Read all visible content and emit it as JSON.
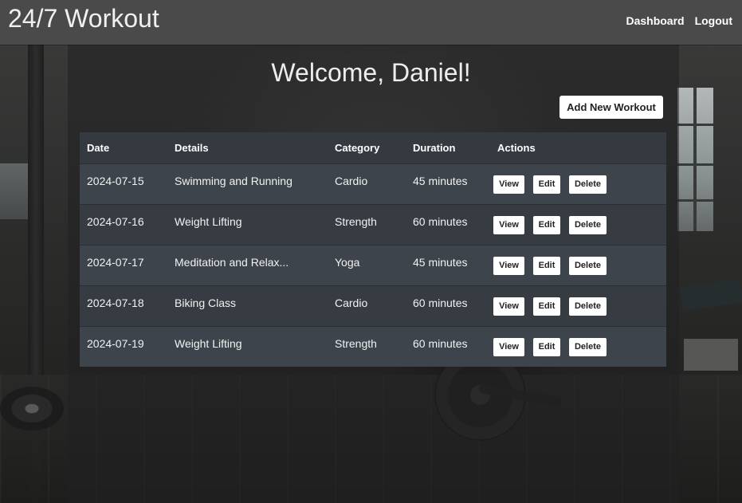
{
  "header": {
    "brand": "24/7 Workout",
    "nav": [
      {
        "label": "Dashboard"
      },
      {
        "label": "Logout"
      }
    ]
  },
  "main": {
    "welcome": "Welcome, Daniel!",
    "add_button_label": "Add New Workout"
  },
  "table": {
    "columns": [
      "Date",
      "Details",
      "Category",
      "Duration",
      "Actions"
    ],
    "rows": [
      {
        "date": "2024-07-15",
        "details": "Swimming and Running",
        "category": "Cardio",
        "duration": "45 minutes"
      },
      {
        "date": "2024-07-16",
        "details": "Weight Lifting",
        "category": "Strength",
        "duration": "60 minutes"
      },
      {
        "date": "2024-07-17",
        "details": "Meditation and Relax...",
        "category": "Yoga",
        "duration": "45 minutes"
      },
      {
        "date": "2024-07-18",
        "details": "Biking Class",
        "category": "Cardio",
        "duration": "60 minutes"
      },
      {
        "date": "2024-07-19",
        "details": "Weight Lifting",
        "category": "Strength",
        "duration": "60 minutes"
      }
    ],
    "actions": {
      "view": "View",
      "edit": "Edit",
      "delete": "Delete"
    }
  },
  "colors": {
    "header_bg": "#4a4a4a",
    "table_header_bg": "#353a40",
    "row_odd_bg": "#3e444b",
    "row_even_bg": "#373c42",
    "button_bg": "#ffffff"
  }
}
